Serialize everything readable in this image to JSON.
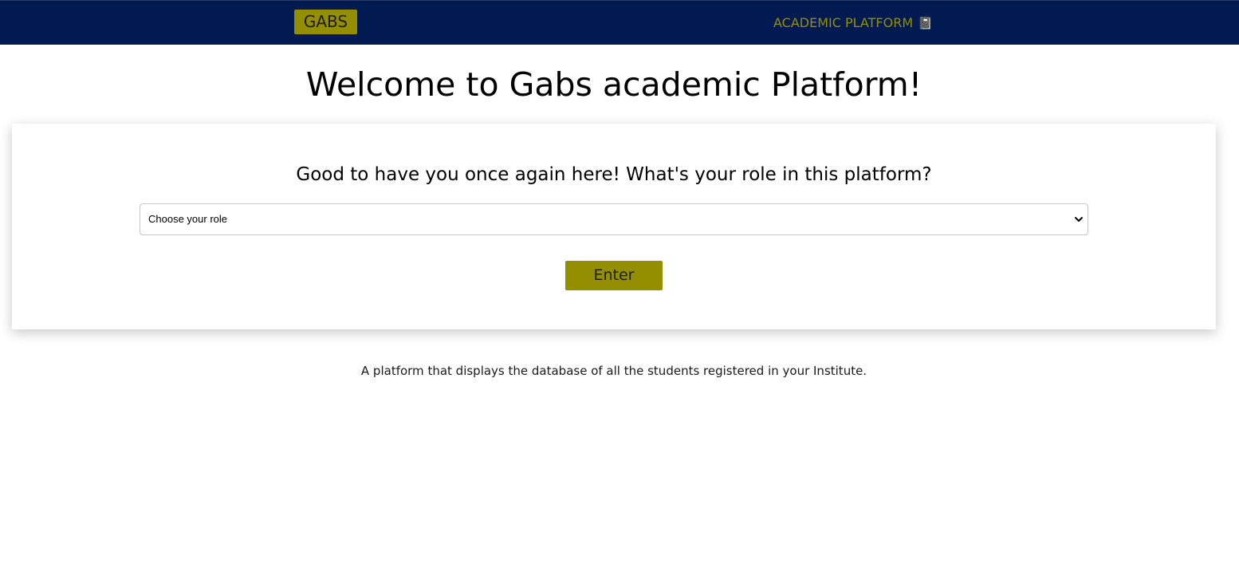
{
  "navbar": {
    "brand_label": "GABS",
    "link_label": "ACADEMIC PLATFORM",
    "link_icon": "book-icon",
    "background_color": "#011a52",
    "accent_color": "#948f00"
  },
  "main": {
    "title": "Welcome to Gabs academic Platform!",
    "card": {
      "question": "Good to have you once again here! What's your role in this platform?",
      "role_select": {
        "selected_value": "Choose your role"
      },
      "enter_label": "Enter"
    },
    "footer_text": "A platform that displays the database of all the students registered in your Institute."
  }
}
